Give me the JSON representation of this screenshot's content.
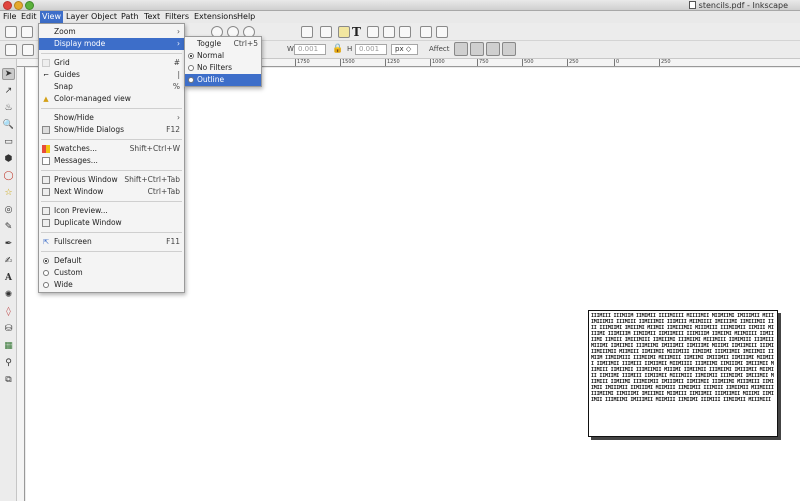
{
  "window": {
    "title": "stencils.pdf - Inkscape"
  },
  "menubar": [
    "File",
    "Edit",
    "View",
    "Layer",
    "Object",
    "Path",
    "Text",
    "Filters",
    "Extensions",
    "Help"
  ],
  "view_menu": {
    "zoom": "Zoom",
    "display_mode": "Display mode",
    "grid": "Grid",
    "grid_shortcut": "#",
    "guides": "Guides",
    "guides_shortcut": "|",
    "snap": "Snap",
    "snap_shortcut": "%",
    "color_managed": "Color-managed view",
    "show_hide": "Show/Hide",
    "show_hide_dialogs": "Show/Hide Dialogs",
    "show_hide_dialogs_shortcut": "F12",
    "swatches": "Swatches...",
    "swatches_shortcut": "Shift+Ctrl+W",
    "messages": "Messages...",
    "previous_window": "Previous Window",
    "previous_window_shortcut": "Shift+Ctrl+Tab",
    "next_window": "Next Window",
    "next_window_shortcut": "Ctrl+Tab",
    "icon_preview": "Icon Preview...",
    "duplicate_window": "Duplicate Window",
    "fullscreen": "Fullscreen",
    "fullscreen_shortcut": "F11",
    "default": "Default",
    "custom": "Custom",
    "wide": "Wide"
  },
  "display_submenu": {
    "toggle": "Toggle",
    "toggle_shortcut": "Ctrl+5",
    "normal": "Normal",
    "no_filters": "No Filters",
    "outline": "Outline"
  },
  "toolbar": {
    "w_label": "W",
    "w_value": "0.001",
    "h_label": "H",
    "h_value": "0.001",
    "unit": "px",
    "affect_label": "Affect"
  },
  "ruler": [
    "1750",
    "1500",
    "1250",
    "1000",
    "750",
    "500",
    "250",
    "0",
    "250"
  ],
  "stencil_text": "IIIMIII IIIMIIM IIMIMII IIIIMIIII MIIIIMII MIIMIIMI IMIIIMII MIII IMIIIMII IIIMIII IIMIIIMII IIIMIII MIIMIIII IMIIIIMI IIMIIIMII IIII IIIMIIMI IMIIIMI MIIMII IIMIIIMII MIIIMIII IIIMIIMII IIMIII MIIIIMI IIIMIIIM IIMIIMII IIMIIMIII IIIMIIIM IIMIIMI MIIMIIII IIMIIIIMI IIMIII IMIIIMIII IIMIIIMI IIIMIIMI MIIIMIII IIMIMIII IIIMIII MIIIMI IIMIIMII IIIMIIMI IMIIIMII IIMIIIMI MIIIMI IIMIIMIII IIIMI IIMIIIMII MIIMIII IIMIIMII MIIIMIII IIMIIMI IIIMIIMII IMIIIMII IIMIIM IIMIIMIII IIIMIIMI MIIIMIII IIMIIMI IMIIIMII IIMIIIMI MIIMIII IIMIIMII IIIMIII IIMIIMII MIIMIIII IIIMIIMI IIMIIIMI IMIIIMII MIIMIII IIMIIMII IIIMIIMII MIIIMI IIMIIMII IIIMIIMI IMIIIMII MIIMIII IIMIIMI IIIMIII IIMIIMII MIIIMIII IIMIIMII IIIMIIMI IMIIIMII MIIMIII IIMIIMI IIIMIIMII IMIIIMII IIMIIMII IIIMIIMI MIIIMIII IIMIIMII IMIIIMII IIMIIIMI MIIMIII IIMIIMII IIIMIII IIMIIMII MIIMIIII IIIMIIMI IIMIIIMI IMIIIMII MIIMIII IIMIIMII IIIMIIMII MIIIMI IIMIIMII IIIMIIMI IMIIIMII MIIMIII IIMIIMI IIIMIII IIMIIMII MIIIMIII"
}
